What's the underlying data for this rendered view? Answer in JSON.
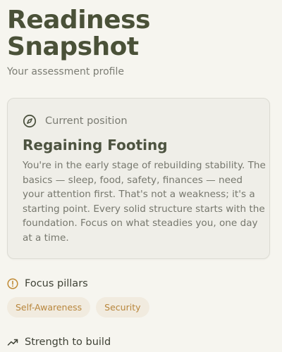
{
  "header": {
    "title_line1": "Readiness",
    "title_line2": "Snapshot",
    "subtitle": "Your assessment profile"
  },
  "position_card": {
    "label": "Current position",
    "icon": "compass-icon",
    "title": "Regaining Footing",
    "body": "You're in the early stage of rebuilding stability. The basics — sleep, food, safety, finances — need your attention first. That's not a weakness; it's a starting point. Every solid structure starts with the foundation. Focus on what steadies you, one day at a time."
  },
  "focus_pillars": {
    "label": "Focus pillars",
    "icon": "alert-circle-icon",
    "items": [
      "Self-Awareness",
      "Security"
    ]
  },
  "strength": {
    "label": "Strength to build",
    "icon": "trending-up-icon"
  },
  "colors": {
    "background": "#f6f5ef",
    "title": "#4a5138",
    "accent": "#b8863c",
    "chip_bg": "#f1ebdf"
  }
}
